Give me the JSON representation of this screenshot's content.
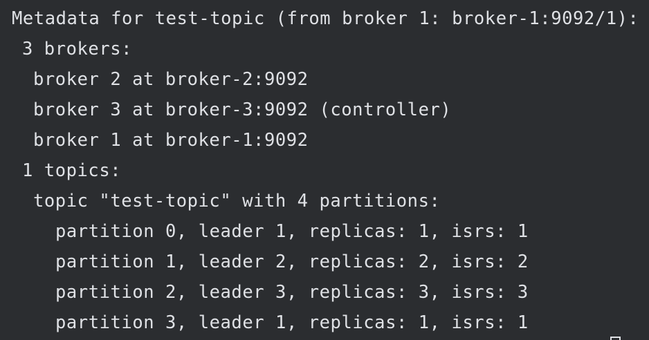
{
  "terminal": {
    "lines": [
      "Metadata for test-topic (from broker 1: broker-1:9092/1):",
      "3 brokers:",
      "broker 2 at broker-2:9092",
      "broker 3 at broker-3:9092 (controller)",
      "broker 1 at broker-1:9092",
      "1 topics:",
      "topic \"test-topic\" with 4 partitions:",
      "partition 0, leader 1, replicas: 1, isrs: 1",
      "partition 1, leader 2, replicas: 2, isrs: 2",
      "partition 2, leader 3, replicas: 3, isrs: 3",
      "partition 3, leader 1, replicas: 1, isrs: 1"
    ]
  },
  "colors": {
    "background": "#2b2d30",
    "text": "#dfe1e5"
  }
}
